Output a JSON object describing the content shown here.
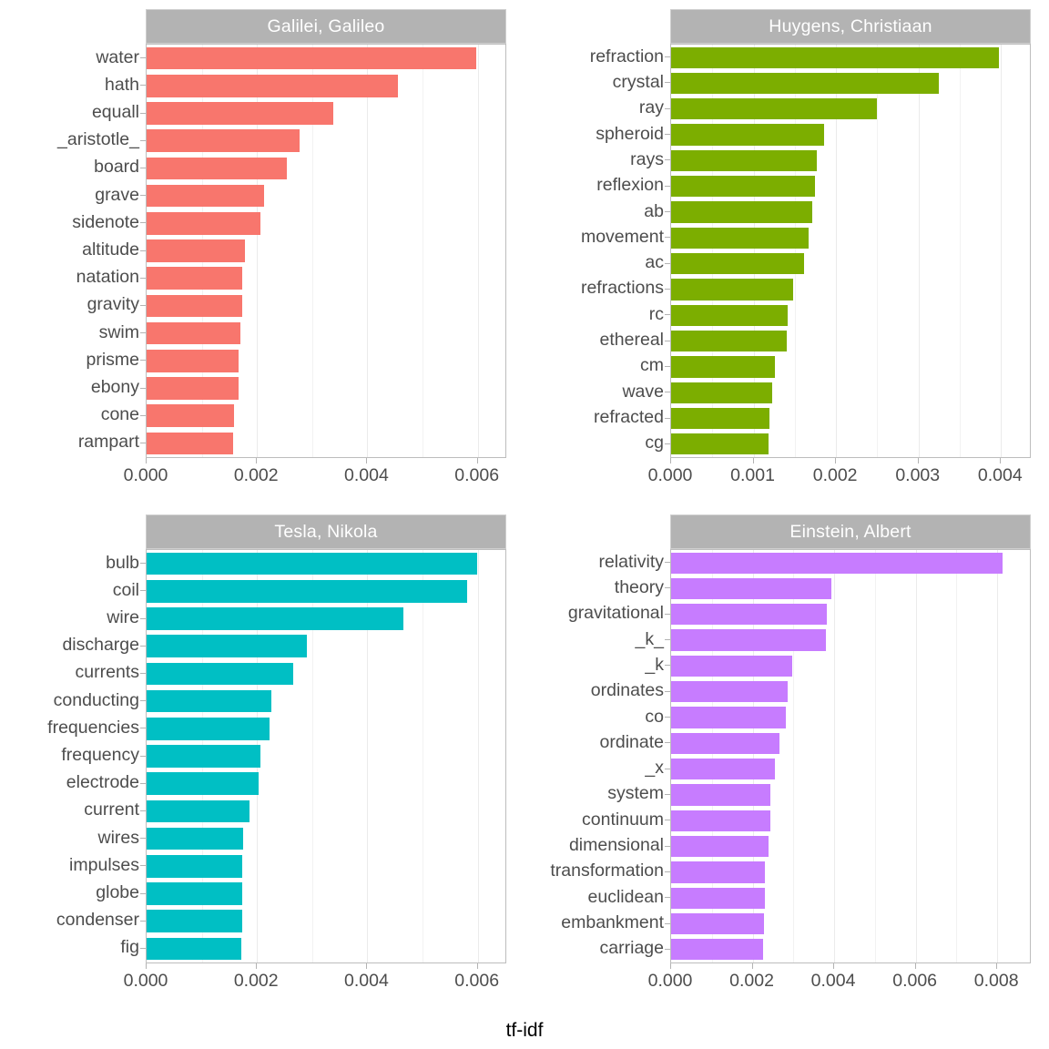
{
  "chart_data": {
    "type": "bar",
    "title": "",
    "xlabel": "tf-idf",
    "ylabel": "",
    "orientation": "horizontal",
    "layout": {
      "facets": 4,
      "grid": "2x2",
      "free_scales": true,
      "grid_major": true,
      "grid_minor": true,
      "legend": "none",
      "strip_background": "#b3b3b3",
      "strip_text_color": "#ffffff",
      "panel_background": "#ffffff",
      "panel_border": "#bdbdbd"
    },
    "panels": [
      {
        "facet": "Galilei, Galileo",
        "color": "#f8766d",
        "xlim": [
          0,
          0.0065
        ],
        "xticks": [
          0,
          0.002,
          0.004,
          0.006
        ],
        "xtick_labels": [
          "0.000",
          "0.002",
          "0.004",
          "0.006"
        ],
        "minor_xticks": [
          0.001,
          0.003,
          0.005
        ],
        "categories": [
          "water",
          "hath",
          "equall",
          "_aristotle_",
          "board",
          "grave",
          "sidenote",
          "altitude",
          "natation",
          "gravity",
          "swim",
          "prisme",
          "ebony",
          "cone",
          "rampart"
        ],
        "values": [
          0.00597,
          0.00456,
          0.00338,
          0.00277,
          0.00254,
          0.00212,
          0.00207,
          0.00178,
          0.00174,
          0.00173,
          0.0017,
          0.00167,
          0.00166,
          0.00158,
          0.00156
        ]
      },
      {
        "facet": "Huygens, Christiaan",
        "color": "#7cae00",
        "xlim": [
          0,
          0.00435
        ],
        "xticks": [
          0,
          0.001,
          0.002,
          0.003,
          0.004
        ],
        "xtick_labels": [
          "0.000",
          "0.001",
          "0.002",
          "0.003",
          "0.004"
        ],
        "minor_xticks": [
          0.0005,
          0.0015,
          0.0025,
          0.0035
        ],
        "categories": [
          "refraction",
          "crystal",
          "ray",
          "spheroid",
          "rays",
          "reflexion",
          "ab",
          "movement",
          "ac",
          "refractions",
          "rc",
          "ethereal",
          "cm",
          "wave",
          "refracted",
          "cg"
        ],
        "values": [
          0.00397,
          0.00325,
          0.0025,
          0.00186,
          0.00177,
          0.00174,
          0.00171,
          0.00167,
          0.00161,
          0.00148,
          0.00141,
          0.0014,
          0.00126,
          0.00122,
          0.00119,
          0.00118
        ]
      },
      {
        "facet": "Tesla, Nikola",
        "color": "#00bfc4",
        "xlim": [
          0,
          0.0065
        ],
        "xticks": [
          0,
          0.002,
          0.004,
          0.006
        ],
        "xtick_labels": [
          "0.000",
          "0.002",
          "0.004",
          "0.006"
        ],
        "minor_xticks": [
          0.001,
          0.003,
          0.005
        ],
        "categories": [
          "bulb",
          "coil",
          "wire",
          "discharge",
          "currents",
          "conducting",
          "frequencies",
          "frequency",
          "electrode",
          "current",
          "wires",
          "impulses",
          "globe",
          "condenser",
          "fig"
        ],
        "values": [
          0.00599,
          0.00581,
          0.00466,
          0.0029,
          0.00265,
          0.00226,
          0.00223,
          0.00206,
          0.00203,
          0.00186,
          0.00175,
          0.00174,
          0.00174,
          0.00174,
          0.00172
        ]
      },
      {
        "facet": "Einstein, Albert",
        "color": "#c77cff",
        "xlim": [
          0,
          0.0088
        ],
        "xticks": [
          0,
          0.002,
          0.004,
          0.006,
          0.008
        ],
        "xtick_labels": [
          "0.000",
          "0.002",
          "0.004",
          "0.006",
          "0.008"
        ],
        "minor_xticks": [
          0.001,
          0.003,
          0.005,
          0.007
        ],
        "categories": [
          "relativity",
          "theory",
          "gravitational",
          "_k_",
          "_k",
          "ordinates",
          "co",
          "ordinate",
          "_x",
          "system",
          "continuum",
          "dimensional",
          "transformation",
          "euclidean",
          "embankment",
          "carriage"
        ],
        "values": [
          0.00812,
          0.00392,
          0.00381,
          0.0038,
          0.00296,
          0.00287,
          0.00282,
          0.00265,
          0.00254,
          0.00244,
          0.00243,
          0.00238,
          0.0023,
          0.00229,
          0.00227,
          0.00225
        ]
      }
    ]
  }
}
